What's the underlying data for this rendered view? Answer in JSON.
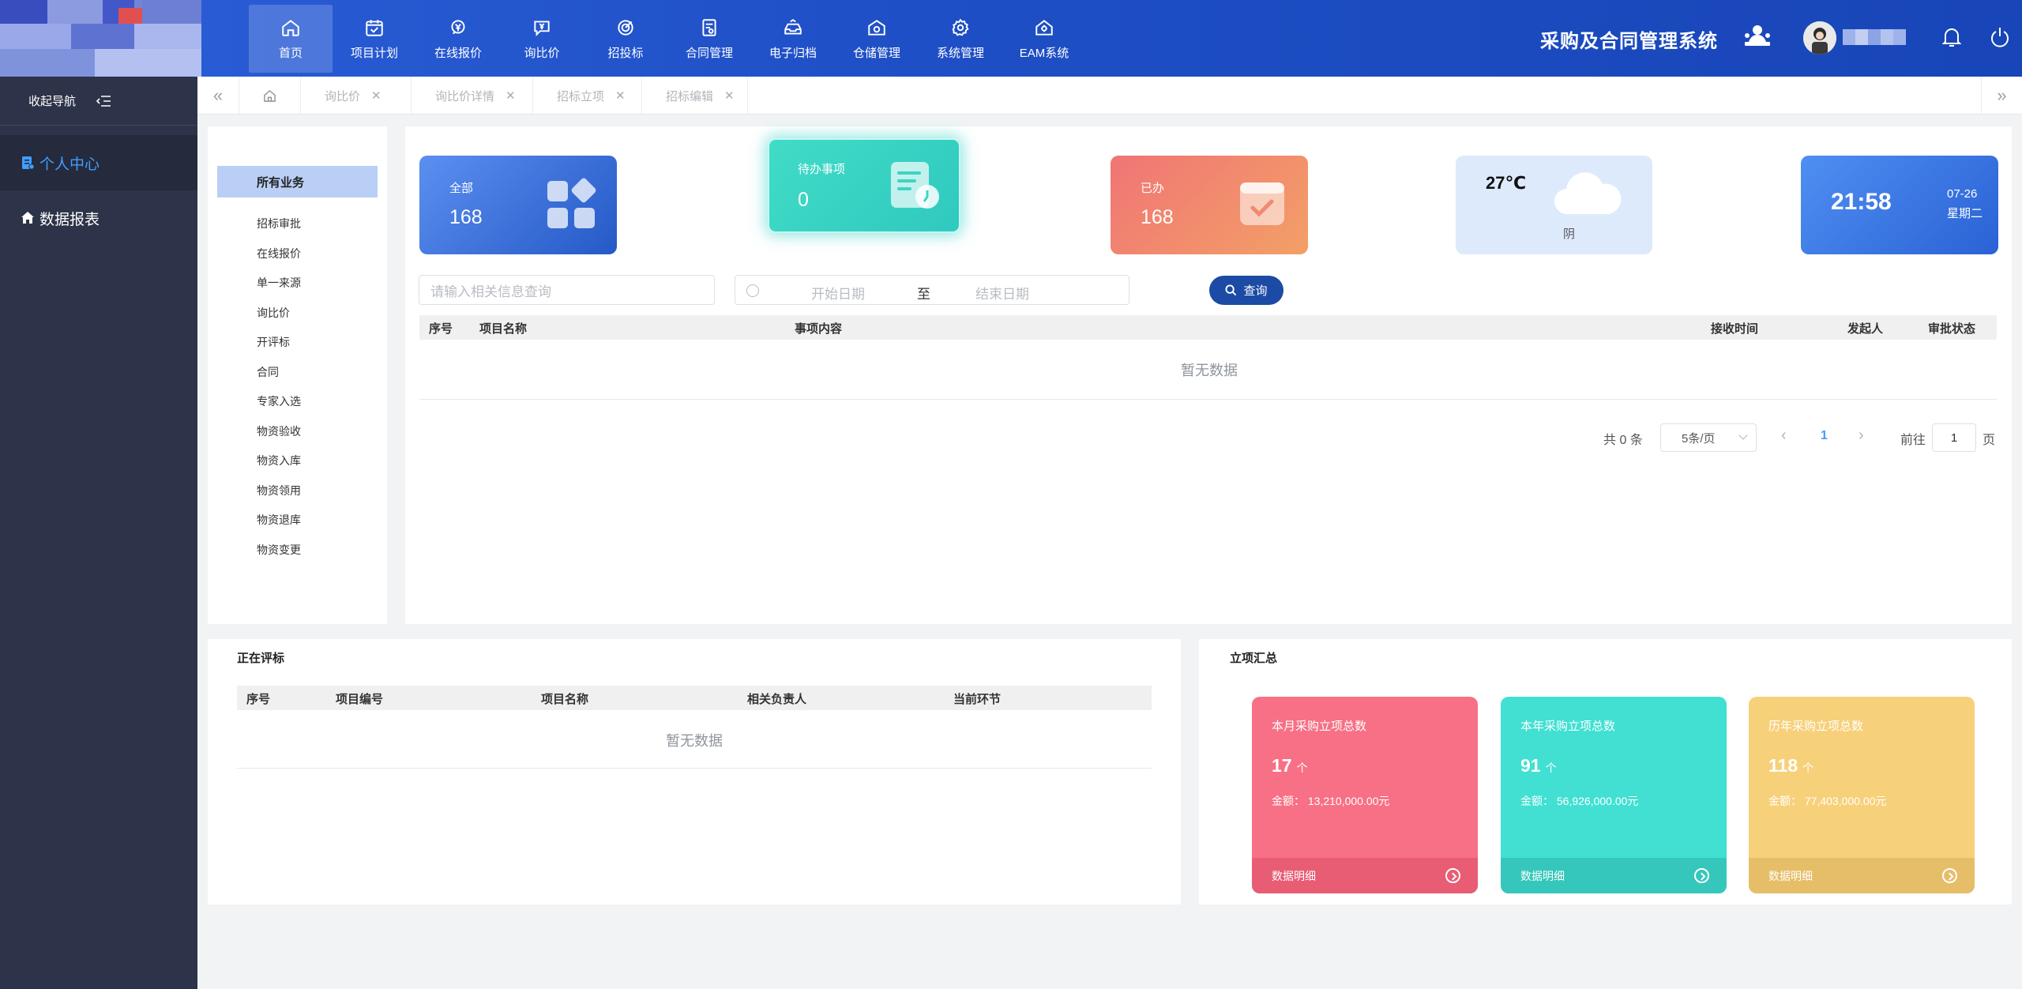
{
  "header": {
    "system_title": "采购及合同管理系统",
    "nav": [
      {
        "label": "首页",
        "icon": "home-icon"
      },
      {
        "label": "项目计划",
        "icon": "calendar-check-icon"
      },
      {
        "label": "在线报价",
        "icon": "yen-quote-icon"
      },
      {
        "label": "询比价",
        "icon": "yen-chat-icon"
      },
      {
        "label": "招投标",
        "icon": "target-icon"
      },
      {
        "label": "合同管理",
        "icon": "contract-icon"
      },
      {
        "label": "电子归档",
        "icon": "archive-icon"
      },
      {
        "label": "仓储管理",
        "icon": "warehouse-icon"
      },
      {
        "label": "系统管理",
        "icon": "gear-icon"
      },
      {
        "label": "EAM系统",
        "icon": "eam-home-icon"
      }
    ]
  },
  "sidebar": {
    "collapse_label": "收起导航",
    "items": [
      {
        "label": "个人中心",
        "icon": "document-icon"
      },
      {
        "label": "数据报表",
        "icon": "home-icon"
      }
    ]
  },
  "tabs": [
    {
      "label": "询比价"
    },
    {
      "label": "询比价详情"
    },
    {
      "label": "招标立项"
    },
    {
      "label": "招标编辑"
    }
  ],
  "business": {
    "title": "所有业务",
    "items": [
      "招标审批",
      "在线报价",
      "单一来源",
      "询比价",
      "开评标",
      "合同",
      "专家入选",
      "物资验收",
      "物资入库",
      "物资领用",
      "物资退库",
      "物资变更"
    ]
  },
  "cards": {
    "all": {
      "label": "全部",
      "value": "168"
    },
    "todo": {
      "label": "待办事项",
      "value": "0"
    },
    "done": {
      "label": "已办",
      "value": "168"
    },
    "weather": {
      "temp": "27℃",
      "desc": "阴"
    },
    "clock": {
      "time": "21:58",
      "date": "07-26",
      "weekday": "星期二"
    }
  },
  "search": {
    "placeholder": "请输入相关信息查询",
    "start_placeholder": "开始日期",
    "separator": "至",
    "end_placeholder": "结束日期",
    "button": "查询"
  },
  "todo_table": {
    "columns": [
      "序号",
      "项目名称",
      "事项内容",
      "接收时间",
      "发起人",
      "审批状态"
    ],
    "empty": "暂无数据"
  },
  "pagination": {
    "total": "共 0 条",
    "page_size": "5条/页",
    "current": "1",
    "goto_label": "前往",
    "goto_value": "1",
    "page_suffix": "页"
  },
  "evaluating": {
    "title": "正在评标",
    "columns": [
      "序号",
      "项目编号",
      "项目名称",
      "相关负责人",
      "当前环节"
    ],
    "empty": "暂无数据"
  },
  "summary": {
    "title": "立项汇总",
    "cards": [
      {
        "title": "本月采购立项总数",
        "count": "17",
        "unit": "个",
        "amount": "金额：  13,210,000.00元",
        "link": "数据明细",
        "color": "#f77085",
        "foot_color": "#e85c74"
      },
      {
        "title": "本年采购立项总数",
        "count": "91",
        "unit": "个",
        "amount": "金额：  56,926,000.00元",
        "link": "数据明细",
        "color": "#41e0d2",
        "foot_color": "#35c7bb"
      },
      {
        "title": "历年采购立项总数",
        "count": "118",
        "unit": "个",
        "amount": "金额：  77,403,000.00元",
        "link": "数据明细",
        "color": "#f7d07a",
        "foot_color": "#e6be68"
      }
    ]
  }
}
